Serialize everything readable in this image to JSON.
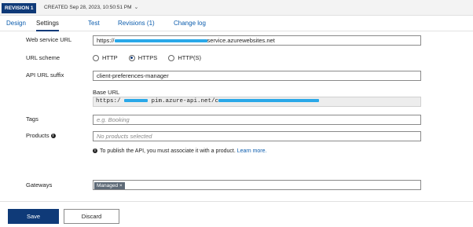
{
  "topbar": {
    "revision_badge": "REVISION 1",
    "created_text": "CREATED Sep 28, 2023, 10:50:51 PM"
  },
  "tabs": [
    "Design",
    "Settings",
    "Test",
    "Revisions (1)",
    "Change log"
  ],
  "active_tab": "Settings",
  "form": {
    "web_service_url": {
      "label": "Web service URL",
      "prefix": "https://",
      "suffix": "service.azurewebsites.net"
    },
    "url_scheme": {
      "label": "URL scheme",
      "options": [
        "HTTP",
        "HTTPS",
        "HTTP(S)"
      ],
      "selected": "HTTPS"
    },
    "api_url_suffix": {
      "label": "API URL suffix",
      "value": "client-preferences-manager"
    },
    "base_url": {
      "label": "Base URL",
      "prefix": "https:/",
      "middle": "pim.azure-api.net/c"
    },
    "tags": {
      "label": "Tags",
      "placeholder": "e.g. Booking"
    },
    "products": {
      "label": "Products",
      "placeholder": "No products selected",
      "notice": "To publish the API, you must associate it with a product.",
      "learn_more": "Learn more."
    },
    "gateways": {
      "label": "Gateways",
      "chip": "Managed"
    }
  },
  "buttons": {
    "save": "Save",
    "discard": "Discard"
  },
  "colors": {
    "brand": "#0f3a78",
    "link": "#0b5cad",
    "redaction": "#2aa8e8"
  }
}
